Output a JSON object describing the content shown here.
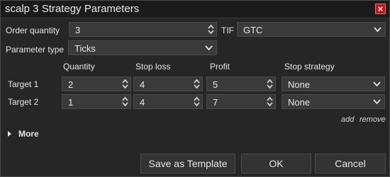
{
  "window": {
    "title": "scalp 3 Strategy Parameters"
  },
  "order": {
    "quantity_label": "Order quantity",
    "quantity_value": "3",
    "tif_label": "TIF",
    "tif_value": "GTC",
    "param_type_label": "Parameter type",
    "param_type_value": "Ticks"
  },
  "targets": {
    "headers": [
      "Quantity",
      "Stop loss",
      "Profit",
      "Stop strategy"
    ],
    "rows": [
      {
        "label": "Target 1",
        "quantity": "2",
        "stop_loss": "4",
        "profit": "5",
        "stop_strategy": "None"
      },
      {
        "label": "Target 2",
        "quantity": "1",
        "stop_loss": "4",
        "profit": "7",
        "stop_strategy": "None"
      }
    ],
    "add_label": "add",
    "remove_label": "remove"
  },
  "more_label": "More",
  "buttons": {
    "save_template": "Save as Template",
    "ok": "OK",
    "cancel": "Cancel"
  },
  "colors": {
    "close_button": "#c11a1a",
    "background": "#262626",
    "field": "#3a3a3a"
  }
}
